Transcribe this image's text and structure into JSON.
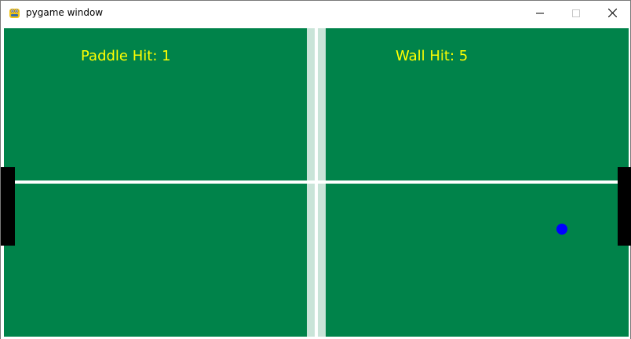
{
  "window": {
    "title": "pygame window",
    "icon": "pygame-snake-icon",
    "controls": [
      "minimize-icon",
      "maximize-icon",
      "close-icon"
    ]
  },
  "game": {
    "score_left": "Paddle Hit: 1",
    "score_right": "Wall Hit: 5",
    "colors": {
      "table": "#00834a",
      "net": "#c9e4d8",
      "lines": "#ffffff",
      "score_text": "#ffff00",
      "paddles": "#000000",
      "ball": "#0000ff"
    }
  }
}
